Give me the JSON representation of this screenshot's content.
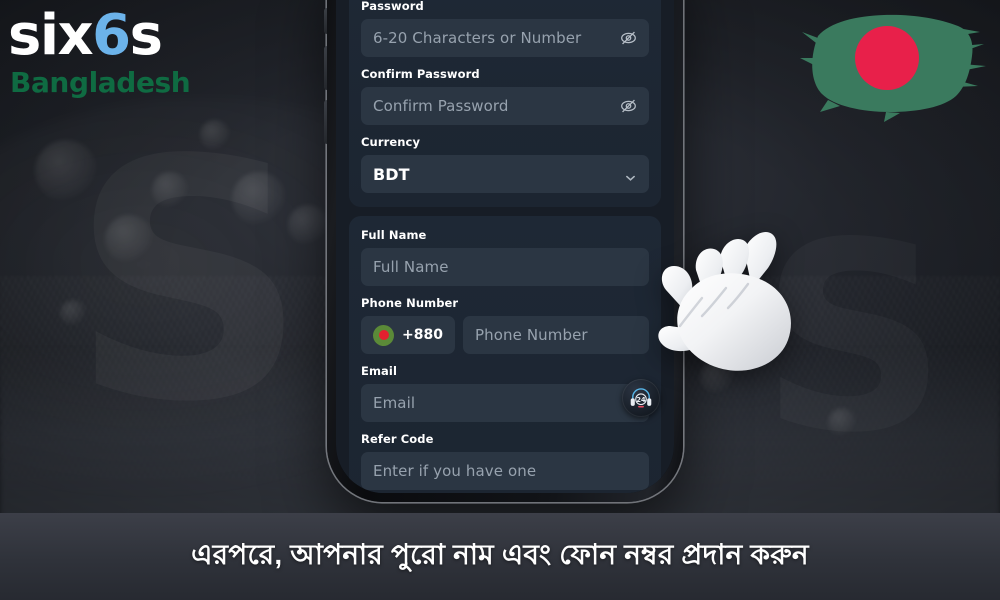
{
  "brand": {
    "name_part1": "six",
    "name_accent": "6",
    "name_part2": "s",
    "region": "Bangladesh",
    "accent_color": "#6cb3ea",
    "region_color": "#0f6b42"
  },
  "flag_badge": {
    "name": "bangladesh-flag",
    "green": "#3a7a5e",
    "red": "#e8204a"
  },
  "phone": {
    "form": {
      "cards": [
        {
          "id": "account-card",
          "fields": [
            {
              "id": "password",
              "label": "Password",
              "placeholder": "6-20 Characters or Number",
              "value": "",
              "trailing_icon": "eye-off-icon"
            },
            {
              "id": "confirm-password",
              "label": "Confirm Password",
              "placeholder": "Confirm Password",
              "value": "",
              "trailing_icon": "eye-off-icon"
            },
            {
              "id": "currency",
              "label": "Currency",
              "placeholder": "",
              "value": "BDT",
              "trailing_icon": "chevron-down-icon"
            }
          ]
        },
        {
          "id": "profile-card",
          "fields": [
            {
              "id": "full-name",
              "label": "Full Name",
              "placeholder": "Full Name",
              "value": ""
            },
            {
              "id": "phone-number",
              "label": "Phone Number",
              "country_code": "+880",
              "country_flag": "bangladesh-flag-circle",
              "placeholder": "Phone Number",
              "value": ""
            },
            {
              "id": "email",
              "label": "Email",
              "placeholder": "Email",
              "value": ""
            },
            {
              "id": "refer-code",
              "label": "Refer Code",
              "placeholder": "Enter if you have one",
              "value": ""
            }
          ]
        }
      ]
    },
    "support_fab": {
      "name": "support-24-7-button",
      "label": "24"
    }
  },
  "cursor": {
    "name": "hand-cursor"
  },
  "caption": {
    "text": "এরপরে, আপনার পুরো নাম এবং ফোন নম্বর প্রদান করুন"
  }
}
